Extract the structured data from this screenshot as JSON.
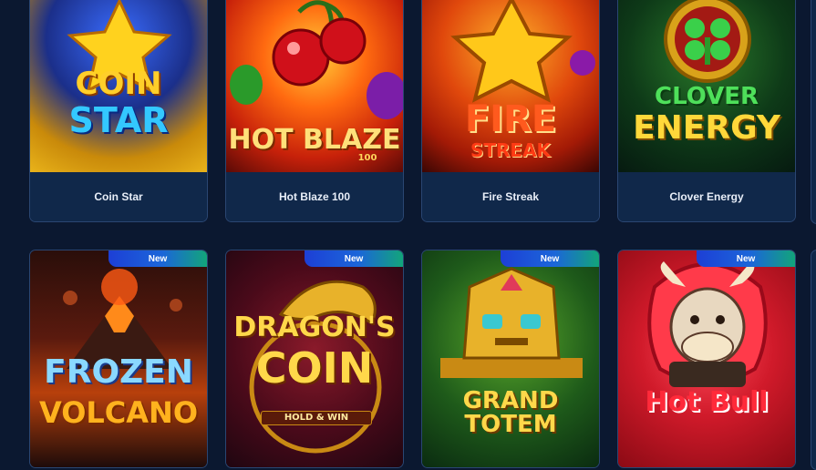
{
  "badges": {
    "new": "New"
  },
  "games": [
    {
      "title": "Coin Star",
      "logo_lines": [
        "COIN",
        "STAR"
      ]
    },
    {
      "title": "Hot Blaze 100",
      "logo_lines": [
        "HOT BLAZE",
        "100"
      ]
    },
    {
      "title": "Fire Streak",
      "logo_lines": [
        "FIRE",
        "STREAK"
      ]
    },
    {
      "title": "Clover Energy",
      "logo_lines": [
        "CLOVER",
        "ENERGY"
      ]
    },
    {
      "title": "Frozen Volcano",
      "logo_lines": [
        "FROZEN",
        "VOLCANO"
      ],
      "is_new": true
    },
    {
      "title": "Dragon's Coin",
      "logo_lines": [
        "DRAGON'S",
        "COIN",
        "HOLD & WIN"
      ],
      "is_new": true
    },
    {
      "title": "Grand Totem",
      "logo_lines": [
        "GRAND TOTEM"
      ],
      "is_new": true
    },
    {
      "title": "Hot Bull",
      "logo_lines": [
        "Hot Bull"
      ],
      "is_new": true
    }
  ],
  "colors": {
    "page_bg": "#0b1830",
    "card_bg": "#10284a",
    "card_border": "#2a4672",
    "badge_start": "#1d3fd6",
    "badge_end": "#12a57a"
  }
}
